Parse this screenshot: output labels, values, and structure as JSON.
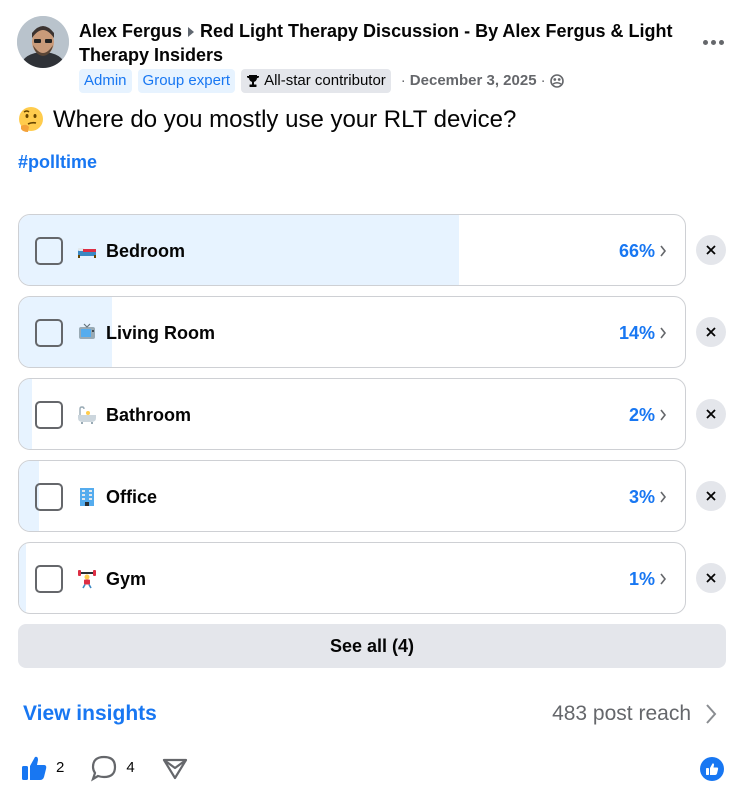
{
  "post": {
    "author": "Alex Fergus",
    "group": "Red Light Therapy Discussion - By Alex Fergus & Light Therapy Insiders",
    "badges": [
      "Admin",
      "Group expert"
    ],
    "contributor_badge": "All-star contributor",
    "date": "December 3, 2025",
    "privacy_icon": "group-members-icon",
    "more_icon": "more-options-icon"
  },
  "question": {
    "emoji": "thinking-face-emoji",
    "text": "Where do you mostly use your RLT device?"
  },
  "hashtag": "#polltime",
  "poll": {
    "options": [
      {
        "label": "Bedroom",
        "percent_text": "66%",
        "percent": 66,
        "emoji": "bed-emoji"
      },
      {
        "label": "Living Room",
        "percent_text": "14%",
        "percent": 14,
        "emoji": "television-emoji"
      },
      {
        "label": "Bathroom",
        "percent_text": "2%",
        "percent": 2,
        "emoji": "bathtub-emoji"
      },
      {
        "label": "Office",
        "percent_text": "3%",
        "percent": 3,
        "emoji": "office-building-emoji"
      },
      {
        "label": "Gym",
        "percent_text": "1%",
        "percent": 1,
        "emoji": "weightlifter-emoji"
      }
    ],
    "see_all": "See all (4)"
  },
  "footer": {
    "insights": "View insights",
    "reach": "483 post reach",
    "like_count": "2",
    "comment_count": "4"
  },
  "colors": {
    "accent": "#1877f2",
    "fill": "#e7f3ff",
    "muted": "#65676b",
    "button_bg": "#e4e6eb"
  }
}
